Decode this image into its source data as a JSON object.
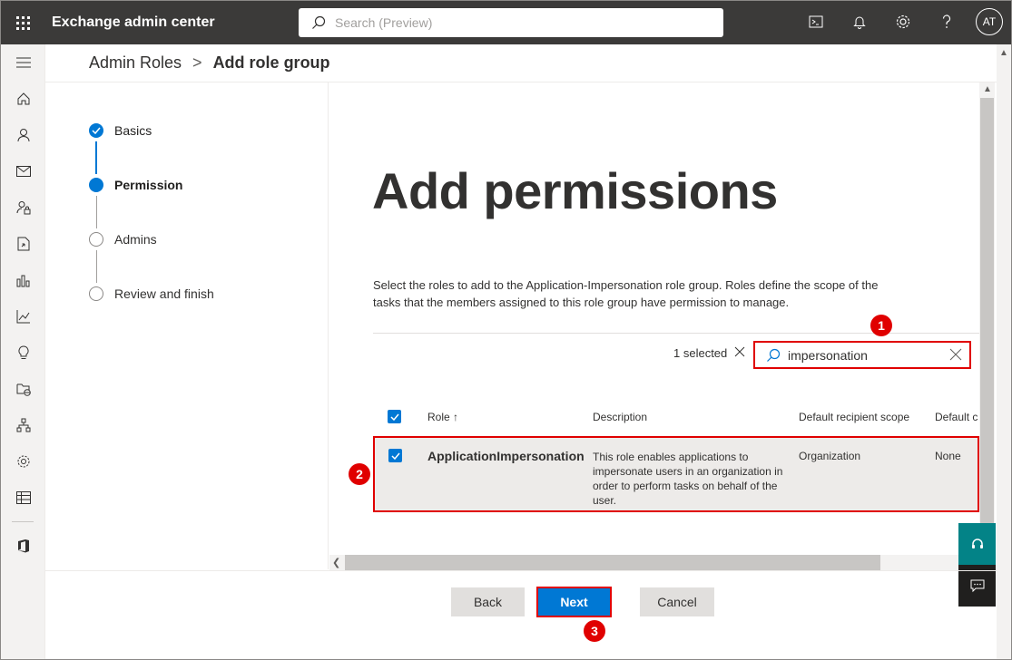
{
  "app": {
    "title": "Exchange admin center"
  },
  "search": {
    "placeholder": "Search (Preview)"
  },
  "topbar": {
    "avatar_initials": "AT"
  },
  "breadcrumb": {
    "parent": "Admin Roles",
    "separator": ">",
    "current": "Add role group"
  },
  "steps": [
    {
      "label": "Basics",
      "state": "done"
    },
    {
      "label": "Permission",
      "state": "current"
    },
    {
      "label": "Admins",
      "state": "pending"
    },
    {
      "label": "Review and finish",
      "state": "pending"
    }
  ],
  "content": {
    "title": "Add permissions",
    "description": "Select the roles to add to the Application-Impersonation role group. Roles define the scope of the tasks that the members assigned to this role group have permission to manage."
  },
  "filter": {
    "selected_text": "1 selected",
    "value": "impersonation"
  },
  "table": {
    "columns": [
      "Role ↑",
      "Description",
      "Default recipient scope",
      "Default c"
    ],
    "rows": [
      {
        "role": "ApplicationImpersonation",
        "description": "This role enables applications to impersonate users in an organization in order to perform tasks on behalf of the user.",
        "scope": "Organization",
        "default": "None"
      }
    ]
  },
  "markers": {
    "m1": "1",
    "m2": "2",
    "m3": "3"
  },
  "footer": {
    "back": "Back",
    "next": "Next",
    "cancel": "Cancel"
  },
  "colors": {
    "accent": "#0078d4",
    "topbar": "#3b3a39",
    "highlight": "#e00000",
    "help": "#038387"
  }
}
